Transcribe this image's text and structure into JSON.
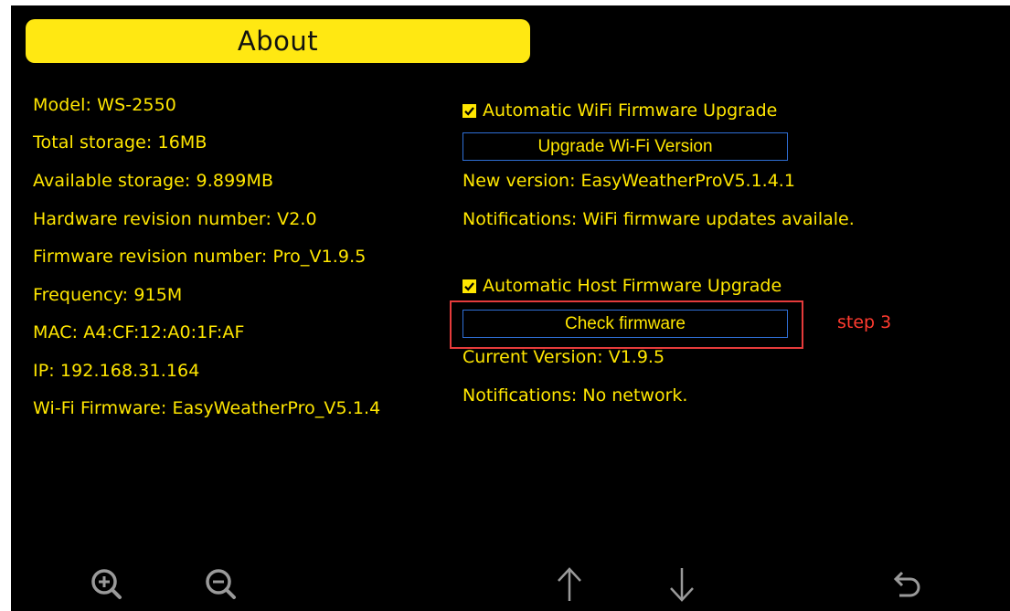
{
  "title": "About",
  "device_info": [
    "Model: WS-2550",
    "Total storage: 16MB",
    "Available storage: 9.899MB",
    "Hardware revision number: V2.0",
    "Firmware revision number: Pro_V1.9.5",
    "Frequency: 915M",
    "MAC: A4:CF:12:A0:1F:AF",
    "IP: 192.168.31.164",
    "Wi-Fi Firmware: EasyWeatherPro_V5.1.4"
  ],
  "wifi_firmware": {
    "auto_label": "Automatic WiFi Firmware Upgrade",
    "auto_checked": true,
    "button_label": "Upgrade Wi-Fi Version",
    "new_version": "New version: EasyWeatherProV5.1.4.1",
    "notifications": "Notifications: WiFi firmware updates availale."
  },
  "host_firmware": {
    "auto_label": "Automatic Host Firmware Upgrade",
    "auto_checked": true,
    "button_label": "Check firmware",
    "current_version": "Current Version: V1.9.5",
    "notifications": "Notifications: No network."
  },
  "annotation": {
    "step_label": "step 3",
    "color": "#e53b3b"
  },
  "colors": {
    "background": "#000000",
    "text": "#ffe600",
    "title_bar": "#ffe812",
    "button_border": "#2f6fd6"
  },
  "bottom_icons": [
    "zoom-in-icon",
    "zoom-out-icon",
    "arrow-up-icon",
    "arrow-down-icon",
    "back-icon"
  ]
}
